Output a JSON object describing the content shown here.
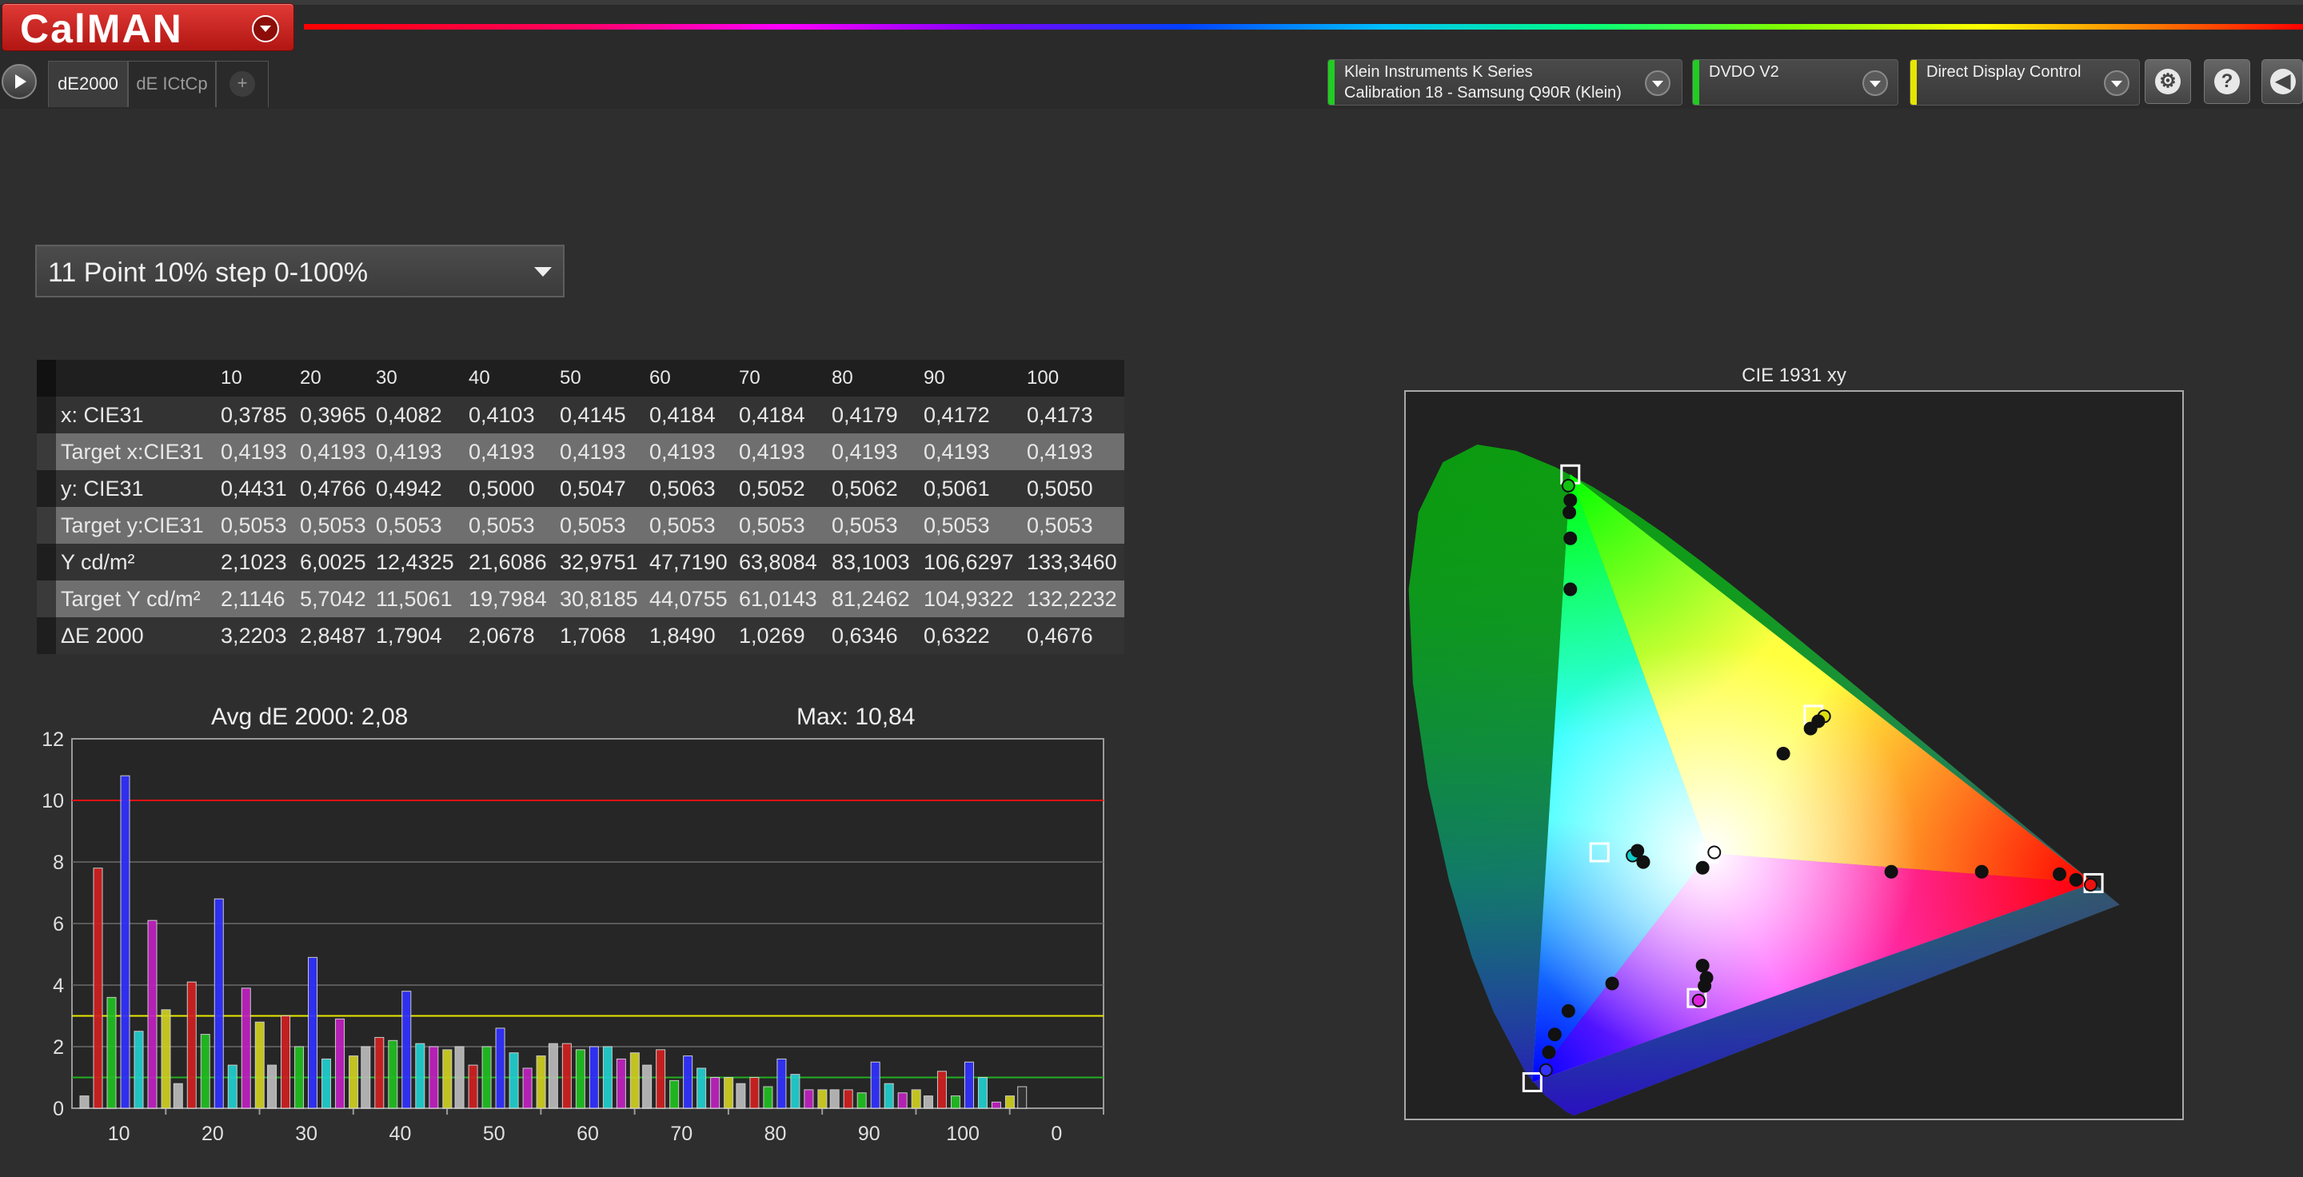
{
  "app": {
    "logo_text": "CalMAN",
    "tabs": [
      "dE2000",
      "dE ICtCp",
      "+"
    ],
    "devices": [
      {
        "line1": "Klein Instruments K Series",
        "line2": "Calibration 18 - Samsung Q90R (Klein)",
        "led_color": "#22cc22"
      },
      {
        "line1": "DVDO V2",
        "line2": "",
        "led_color": "#22cc22"
      },
      {
        "line1": "Direct Display Control",
        "line2": "",
        "led_color": "#e6e600"
      }
    ],
    "right_buttons": [
      "gear-icon",
      "?",
      "back-icon"
    ]
  },
  "preset": {
    "selected": "11 Point 10% step 0-100%"
  },
  "table": {
    "headers": [
      "",
      "10",
      "20",
      "30",
      "40",
      "50",
      "60",
      "70",
      "80",
      "90",
      "100"
    ],
    "rows": [
      {
        "label": "x: CIE31",
        "values": [
          "0,3785",
          "0,3965",
          "0,4082",
          "0,4103",
          "0,4145",
          "0,4184",
          "0,4184",
          "0,4179",
          "0,4172",
          "0,4173"
        ]
      },
      {
        "label": "Target x:CIE31",
        "values": [
          "0,4193",
          "0,4193",
          "0,4193",
          "0,4193",
          "0,4193",
          "0,4193",
          "0,4193",
          "0,4193",
          "0,4193",
          "0,4193"
        ]
      },
      {
        "label": "y: CIE31",
        "values": [
          "0,4431",
          "0,4766",
          "0,4942",
          "0,5000",
          "0,5047",
          "0,5063",
          "0,5052",
          "0,5062",
          "0,5061",
          "0,5050"
        ]
      },
      {
        "label": "Target y:CIE31",
        "values": [
          "0,5053",
          "0,5053",
          "0,5053",
          "0,5053",
          "0,5053",
          "0,5053",
          "0,5053",
          "0,5053",
          "0,5053",
          "0,5053"
        ]
      },
      {
        "label": "Y cd/m²",
        "values": [
          "2,1023",
          "6,0025",
          "12,4325",
          "21,6086",
          "32,9751",
          "47,7190",
          "63,8084",
          "83,1003",
          "106,6297",
          "133,3460"
        ]
      },
      {
        "label": "Target Y cd/m²",
        "values": [
          "2,1146",
          "5,7042",
          "11,5061",
          "19,7984",
          "30,8185",
          "44,0755",
          "61,0143",
          "81,2462",
          "104,9322",
          "132,2232"
        ]
      },
      {
        "label": "ΔE 2000",
        "values": [
          "3,2203",
          "2,8487",
          "1,7904",
          "2,0678",
          "1,7068",
          "1,8490",
          "1,0269",
          "0,6346",
          "0,6322",
          "0,4676"
        ]
      }
    ]
  },
  "chart_data": [
    {
      "type": "bar",
      "title_left": "Avg dE 2000: 2,08",
      "title_right": "Max: 10,84",
      "categories": [
        "10",
        "20",
        "30",
        "40",
        "50",
        "60",
        "70",
        "80",
        "90",
        "100",
        "0"
      ],
      "ylim": [
        0,
        12
      ],
      "yticks": [
        0,
        2,
        4,
        6,
        8,
        10,
        12
      ],
      "grid": true,
      "thresholds": [
        {
          "value": 10,
          "color": "#e01010"
        },
        {
          "value": 3,
          "color": "#e8e800"
        },
        {
          "value": 1,
          "color": "#20b020"
        }
      ],
      "series": [
        {
          "color": "#bbbbbb",
          "values": [
            0.4,
            0.8,
            1.4,
            2.0,
            2.0,
            2.1,
            1.4,
            0.8,
            0.6,
            0.4,
            0.7
          ]
        },
        {
          "color": "#d02020",
          "values": [
            7.8,
            4.1,
            3.0,
            2.3,
            1.4,
            2.1,
            1.9,
            1.0,
            0.6,
            1.2,
            null
          ]
        },
        {
          "color": "#20c020",
          "values": [
            3.6,
            2.4,
            2.0,
            2.2,
            2.0,
            1.9,
            0.9,
            0.7,
            0.5,
            0.4,
            null
          ]
        },
        {
          "color": "#3030ff",
          "values": [
            10.8,
            6.8,
            4.9,
            3.8,
            2.6,
            2.0,
            1.7,
            1.6,
            1.5,
            1.5,
            null
          ]
        },
        {
          "color": "#20d0d0",
          "values": [
            2.5,
            1.4,
            1.6,
            2.1,
            1.8,
            2.0,
            1.3,
            1.1,
            0.8,
            1.0,
            null
          ]
        },
        {
          "color": "#c020c0",
          "values": [
            6.1,
            3.9,
            2.9,
            2.0,
            1.3,
            1.6,
            1.0,
            0.6,
            0.5,
            0.2,
            null
          ]
        },
        {
          "color": "#d0d020",
          "values": [
            3.2,
            2.8,
            1.7,
            1.9,
            1.7,
            1.8,
            1.0,
            0.6,
            0.6,
            0.4,
            null
          ]
        }
      ]
    },
    {
      "type": "scatter",
      "title": "CIE 1931 xy",
      "xlim": [
        0,
        0.8
      ],
      "ylim": [
        0,
        0.9
      ],
      "gamut": [
        [
          0.708,
          0.292
        ],
        [
          0.17,
          0.797
        ],
        [
          0.131,
          0.046
        ]
      ],
      "white_target": [
        0.3127,
        0.329
      ],
      "targets": [
        {
          "name": "red",
          "x": 0.708,
          "y": 0.292
        },
        {
          "name": "green",
          "x": 0.17,
          "y": 0.797
        },
        {
          "name": "blue",
          "x": 0.131,
          "y": 0.046
        },
        {
          "name": "cyan",
          "x": 0.2,
          "y": 0.33
        },
        {
          "name": "magenta",
          "x": 0.3,
          "y": 0.15
        },
        {
          "name": "yellow",
          "x": 0.42,
          "y": 0.5
        },
        {
          "name": "white",
          "x": 0.3127,
          "y": 0.329
        }
      ],
      "measured": [
        {
          "x": 0.168,
          "y": 0.783,
          "c": "#11c011"
        },
        {
          "x": 0.17,
          "y": 0.765,
          "c": "#111"
        },
        {
          "x": 0.169,
          "y": 0.75,
          "c": "#111"
        },
        {
          "x": 0.17,
          "y": 0.718,
          "c": "#111"
        },
        {
          "x": 0.17,
          "y": 0.655,
          "c": "#111"
        },
        {
          "x": 0.234,
          "y": 0.326,
          "c": "#11cccc"
        },
        {
          "x": 0.245,
          "y": 0.318,
          "c": "#111"
        },
        {
          "x": 0.239,
          "y": 0.332,
          "c": "#111"
        },
        {
          "x": 0.145,
          "y": 0.061,
          "c": "#3333ff"
        },
        {
          "x": 0.148,
          "y": 0.083,
          "c": "#111"
        },
        {
          "x": 0.154,
          "y": 0.105,
          "c": "#111"
        },
        {
          "x": 0.168,
          "y": 0.134,
          "c": "#111"
        },
        {
          "x": 0.213,
          "y": 0.168,
          "c": "#111"
        },
        {
          "x": 0.302,
          "y": 0.147,
          "c": "#dd22dd"
        },
        {
          "x": 0.308,
          "y": 0.165,
          "c": "#111"
        },
        {
          "x": 0.306,
          "y": 0.19,
          "c": "#111"
        },
        {
          "x": 0.31,
          "y": 0.175,
          "c": "#111"
        },
        {
          "x": 0.705,
          "y": 0.29,
          "c": "#ee1111"
        },
        {
          "x": 0.69,
          "y": 0.296,
          "c": "#111"
        },
        {
          "x": 0.673,
          "y": 0.303,
          "c": "#111"
        },
        {
          "x": 0.593,
          "y": 0.306,
          "c": "#111"
        },
        {
          "x": 0.5,
          "y": 0.306,
          "c": "#111"
        },
        {
          "x": 0.431,
          "y": 0.498,
          "c": "#dddd11"
        },
        {
          "x": 0.425,
          "y": 0.492,
          "c": "#111"
        },
        {
          "x": 0.417,
          "y": 0.483,
          "c": "#111"
        },
        {
          "x": 0.389,
          "y": 0.452,
          "c": "#111"
        },
        {
          "x": 0.306,
          "y": 0.311,
          "c": "#111"
        },
        {
          "x": 0.318,
          "y": 0.33,
          "c": "#ffffff"
        }
      ]
    }
  ]
}
